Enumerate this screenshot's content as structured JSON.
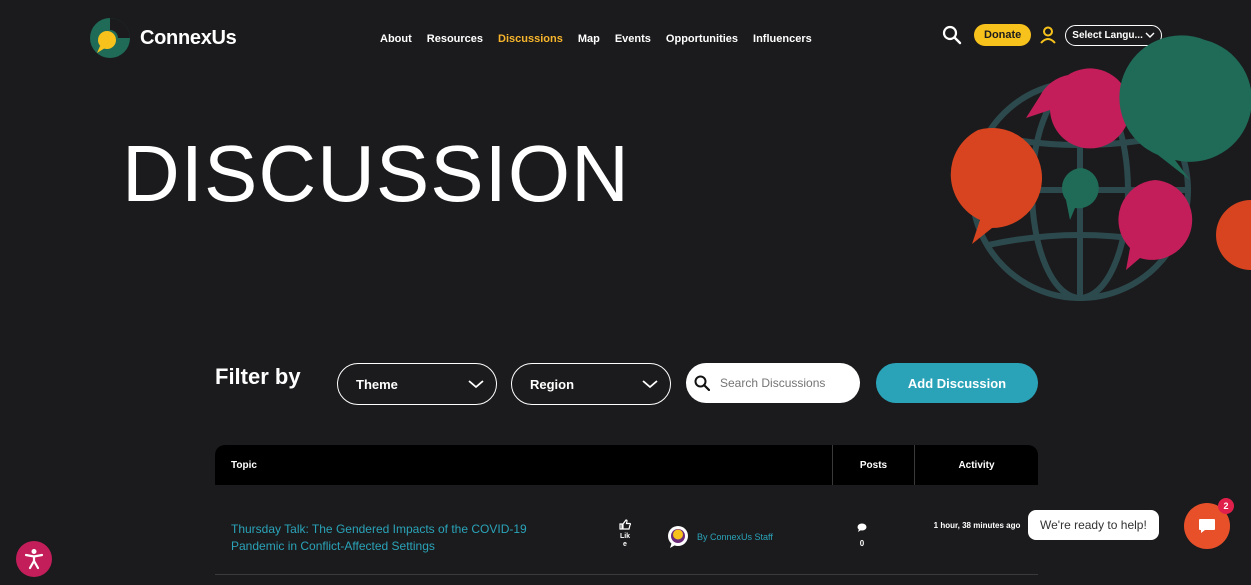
{
  "brand": {
    "name": "ConnexUs"
  },
  "nav": {
    "items": [
      {
        "label": "About"
      },
      {
        "label": "Resources"
      },
      {
        "label": "Discussions",
        "active": true
      },
      {
        "label": "Map"
      },
      {
        "label": "Events"
      },
      {
        "label": "Opportunities"
      },
      {
        "label": "Influencers"
      }
    ]
  },
  "header": {
    "donate_label": "Donate",
    "language_label": "Select Langu..."
  },
  "hero": {
    "title": "DISCUSSION"
  },
  "filters": {
    "label": "Filter by",
    "theme_label": "Theme",
    "region_label": "Region",
    "search_placeholder": "Search Discussions",
    "add_label": "Add Discussion"
  },
  "table": {
    "headers": {
      "topic": "Topic",
      "posts": "Posts",
      "activity": "Activity"
    },
    "rows": [
      {
        "topic": "Thursday Talk: The Gendered Impacts of the COVID-19 Pandemic in Conflict-Affected Settings",
        "like_label": "Lik e",
        "author": "By ConnexUs Staff",
        "posts": "0",
        "activity": "1 hour, 38 minutes ago"
      }
    ]
  },
  "chat": {
    "help_text": "We're ready to help!",
    "badge_count": "2"
  },
  "colors": {
    "background": "#1b1b1d",
    "accent_teal": "#2aa3b8",
    "accent_yellow": "#f8c21d",
    "accent_orange": "#e8502a",
    "accent_magenta": "#c41e5a",
    "accent_green": "#1f6b57"
  }
}
